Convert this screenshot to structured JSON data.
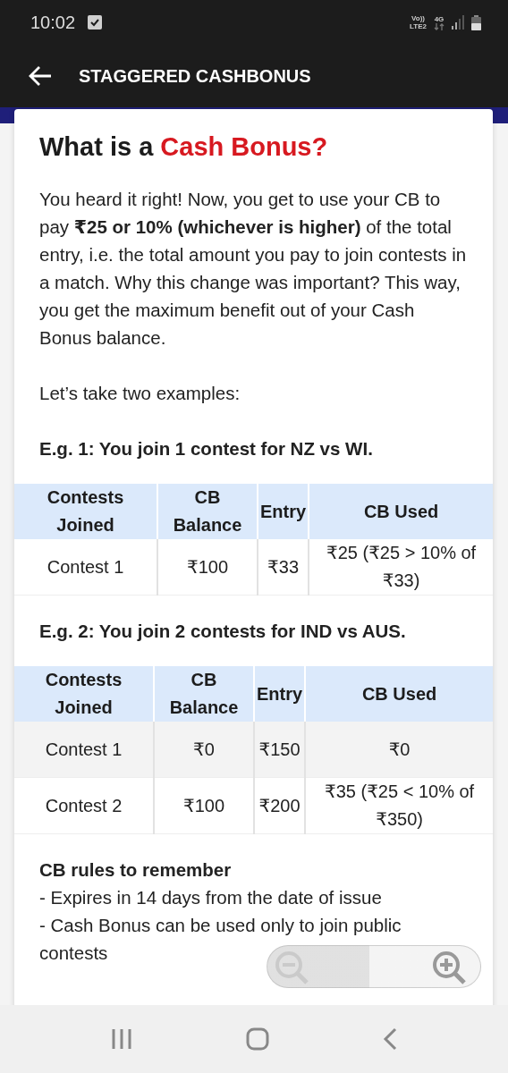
{
  "status_bar": {
    "time": "10:02",
    "volte_label": "Vo))",
    "lte_label": "LTE2",
    "network_label": "4G"
  },
  "app_bar": {
    "title": "STAGGERED CASHBONUS"
  },
  "article": {
    "title_prefix": "What is a",
    "title_highlight": "Cash Bonus?",
    "intro": "You heard it right! Now, you get to use your CB to pay **₹25 or 10% (whichever is higher)** of the total entry, i.e. the total amount you pay to join contests in a match. Why this change was important? This way, you get the maximum benefit out of your Cash Bonus balance.",
    "lead": "Let’s take two examples:",
    "examples": [
      {
        "heading": "E.g. 1: You join 1 contest for NZ vs WI.",
        "table": {
          "columns": [
            "Contests Joined",
            "CB Balance",
            "Entry",
            "CB Used"
          ],
          "rows": [
            {
              "shaded": false,
              "cells": [
                "Contest 1",
                "₹100",
                "₹33",
                "₹25 (₹25 > 10% of ₹33)"
              ]
            }
          ]
        }
      },
      {
        "heading": "E.g. 2: You join 2 contests for IND vs AUS.",
        "table": {
          "columns": [
            "Contests Joined",
            "CB Balance",
            "Entry",
            "CB Used"
          ],
          "rows": [
            {
              "shaded": true,
              "cells": [
                "Contest 1",
                "₹0",
                "₹150",
                "₹0"
              ]
            },
            {
              "shaded": false,
              "cells": [
                "Contest 2",
                "₹100",
                "₹200",
                "₹35 (₹25 < 10% of ₹350)"
              ]
            }
          ]
        }
      }
    ],
    "rules": {
      "heading": "CB rules to remember",
      "items": [
        "- Expires in 14 days from the date of issue",
        "- Cash Bonus can be used only to join public contests"
      ]
    }
  }
}
